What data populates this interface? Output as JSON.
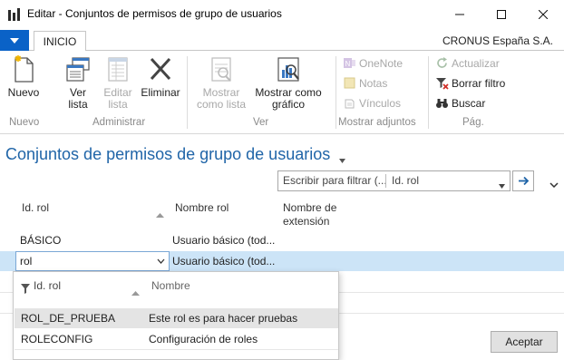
{
  "window": {
    "title": "Editar - Conjuntos de permisos de grupo de usuarios"
  },
  "ribbon": {
    "tab": "INICIO",
    "company": "CRONUS España S.A.",
    "buttons": {
      "nuevo": "Nuevo",
      "ver_lista": "Ver lista",
      "ver_lista_1": "Ver",
      "ver_lista_2": "lista",
      "editar_lista_1": "Editar",
      "editar_lista_2": "lista",
      "eliminar": "Eliminar",
      "mostrar_lista_1": "Mostrar",
      "mostrar_lista_2": "como lista",
      "mostrar_grafico_1": "Mostrar como",
      "mostrar_grafico_2": "gráfico",
      "onenote": "OneNote",
      "notas": "Notas",
      "vinculos": "Vínculos",
      "actualizar": "Actualizar",
      "borrar_filtro": "Borrar filtro",
      "buscar": "Buscar"
    },
    "groups": {
      "nuevo": "Nuevo",
      "administrar": "Administrar",
      "ver": "Ver",
      "mostrar_adjuntos": "Mostrar adjuntos",
      "pag": "Pág."
    }
  },
  "page": {
    "title": "Conjuntos de permisos de grupo de usuarios"
  },
  "filter": {
    "placeholder": "Escribir para filtrar (...",
    "field": "Id. rol"
  },
  "grid": {
    "headers": {
      "id_rol": "Id. rol",
      "nombre_rol": "Nombre rol",
      "nombre_ext_1": "Nombre de",
      "nombre_ext_2": "extensión"
    },
    "rows": [
      {
        "id": "BÁSICO",
        "nombre": "Usuario básico (tod..."
      },
      {
        "id": "rol",
        "nombre": "Usuario básico (tod..."
      }
    ]
  },
  "lookup": {
    "headers": {
      "id": "Id. rol",
      "nombre": "Nombre"
    },
    "rows": [
      {
        "id": "ROL_DE_PRUEBA",
        "nombre": "Este rol es para hacer pruebas"
      },
      {
        "id": "ROLECONFIG",
        "nombre": "Configuración de roles"
      }
    ]
  },
  "footer": {
    "accept": "Aceptar"
  },
  "colors": {
    "accent_blue": "#2065a8",
    "ribbon_menu": "#0a62c7",
    "selected_row": "#cce4f7",
    "lookup_selected": "#e4e4e4"
  }
}
